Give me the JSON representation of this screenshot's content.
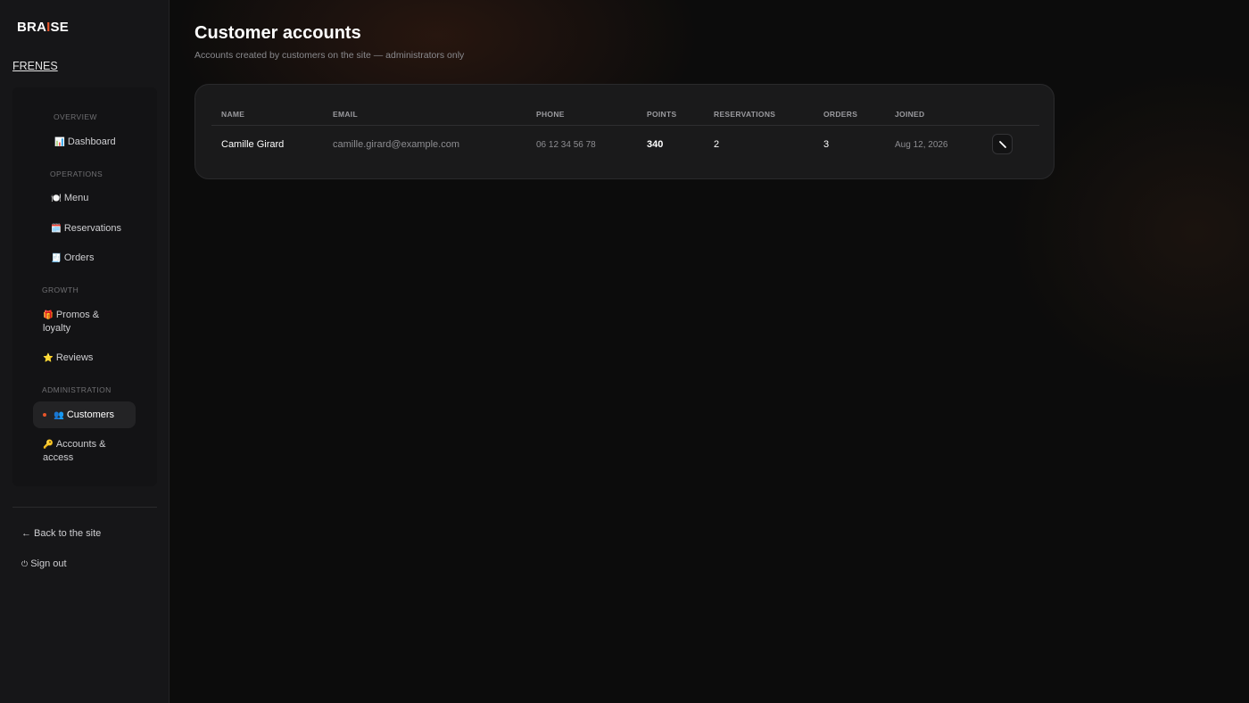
{
  "brand": {
    "logo_pre": "BRA",
    "logo_mark": "I",
    "logo_post": "SE",
    "restaurant": "FRENES",
    "accent": "#e8552a"
  },
  "sidebar": {
    "sections": [
      "OVERVIEW",
      "OPERATIONS",
      "GROWTH",
      "ADMINISTRATION"
    ],
    "items": [
      {
        "icon": "📊",
        "label": "Dashboard"
      },
      {
        "icon": "🍽️",
        "label": "Menu"
      },
      {
        "icon": "🗓️",
        "label": "Reservations"
      },
      {
        "icon": "🧾",
        "label": "Orders"
      },
      {
        "icon": "🎁",
        "label": "Promos &",
        "label2": "loyalty"
      },
      {
        "icon": "⭐",
        "label": "Reviews"
      },
      {
        "icon": "👥",
        "label": "Customers",
        "active": true
      },
      {
        "icon": "🔑",
        "label": "Accounts &",
        "label2": "access"
      }
    ],
    "footer": {
      "back": "← Back to the site",
      "signout_icon": "⏻",
      "signout": "Sign out"
    }
  },
  "page": {
    "title": "Customer accounts",
    "subtitle": "Accounts created by customers on the site — administrators only"
  },
  "table": {
    "columns": [
      "NAME",
      "EMAIL",
      "PHONE",
      "POINTS",
      "RESERVATIONS",
      "ORDERS",
      "JOINED"
    ],
    "rows": [
      {
        "name": "Camille Girard",
        "email": "camille.girard@example.com",
        "phone": "06 12 34 56 78",
        "points": "340",
        "reservations": "2",
        "orders": "3",
        "joined": "Aug 12, 2026"
      }
    ]
  }
}
